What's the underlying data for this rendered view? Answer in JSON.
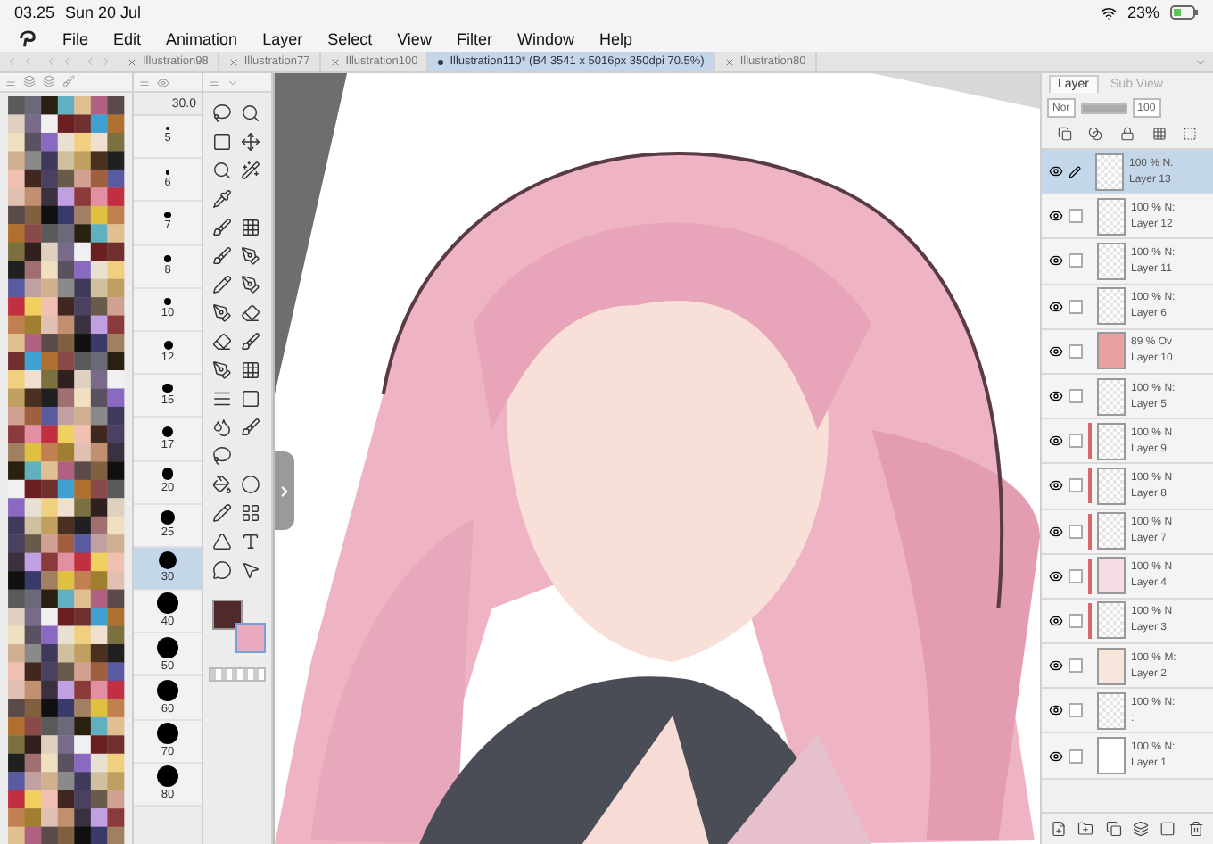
{
  "status_bar": {
    "time": "03.25",
    "date": "Sun 20 Jul",
    "battery": "23%"
  },
  "menu": [
    "File",
    "Edit",
    "Animation",
    "Layer",
    "Select",
    "View",
    "Filter",
    "Window",
    "Help"
  ],
  "document_tabs": [
    {
      "label": "Illustration98",
      "selected": false
    },
    {
      "label": "Illustration77",
      "selected": false
    },
    {
      "label": "Illustration100",
      "selected": false
    },
    {
      "label": "Illustration110* (B4 3541 x 5016px 350dpi 70.5%)",
      "selected": true
    },
    {
      "label": "Illustration80",
      "selected": false
    }
  ],
  "brush_size": {
    "value": "30.0",
    "sizes": [
      {
        "label": "5",
        "selected": false
      },
      {
        "label": "6",
        "selected": false
      },
      {
        "label": "7",
        "selected": false
      },
      {
        "label": "8",
        "selected": false
      },
      {
        "label": "10",
        "selected": false
      },
      {
        "label": "12",
        "selected": false
      },
      {
        "label": "15",
        "selected": false
      },
      {
        "label": "17",
        "selected": false
      },
      {
        "label": "20",
        "selected": false
      },
      {
        "label": "25",
        "selected": false
      },
      {
        "label": "30",
        "selected": true
      },
      {
        "label": "40",
        "selected": false
      },
      {
        "label": "50",
        "selected": false
      },
      {
        "label": "60",
        "selected": false
      },
      {
        "label": "70",
        "selected": false
      },
      {
        "label": "80",
        "selected": false
      }
    ]
  },
  "colors": {
    "main": {
      "color": "#4e2a2c"
    },
    "sub": {
      "color": "#e8aabc"
    }
  },
  "layer_panel": {
    "tabs": [
      {
        "label": "Layer",
        "selected": true
      },
      {
        "label": "Sub View",
        "selected": false
      }
    ],
    "blend": "Nor",
    "opacity": "100",
    "opacity_slider": {
      "level": 1
    },
    "layers": [
      {
        "name": "Layer 13",
        "opacity": "100 %",
        "blend": "N:",
        "selected": true,
        "clipped": false,
        "kind": "empty"
      },
      {
        "name": "Layer 12",
        "opacity": "100 %",
        "blend": "N:",
        "selected": false,
        "clipped": false,
        "kind": "sketch"
      },
      {
        "name": "Layer 11",
        "opacity": "100 %",
        "blend": "N:",
        "selected": false,
        "clipped": false,
        "kind": "empty"
      },
      {
        "name": "Layer 6",
        "opacity": "100 %",
        "blend": "N:",
        "selected": false,
        "clipped": false,
        "kind": "empty"
      },
      {
        "name": "Layer 10",
        "opacity": "89 %",
        "blend": "Ov",
        "selected": false,
        "clipped": false,
        "kind": "red"
      },
      {
        "name": "Layer 5",
        "opacity": "100 %",
        "blend": "N:",
        "selected": false,
        "clipped": false,
        "kind": "empty"
      },
      {
        "name": "Layer 9",
        "opacity": "100 %",
        "blend": "N",
        "selected": false,
        "clipped": true,
        "kind": "empty"
      },
      {
        "name": "Layer 8",
        "opacity": "100 %",
        "blend": "N",
        "selected": false,
        "clipped": true,
        "kind": "sketch"
      },
      {
        "name": "Layer 7",
        "opacity": "100 %",
        "blend": "N",
        "selected": false,
        "clipped": true,
        "kind": "sketch"
      },
      {
        "name": "Layer 4",
        "opacity": "100 %",
        "blend": "N",
        "selected": false,
        "clipped": true,
        "kind": "pink"
      },
      {
        "name": "Layer 3",
        "opacity": "100 %",
        "blend": "N",
        "selected": false,
        "clipped": true,
        "kind": "empty"
      },
      {
        "name": "Layer 2",
        "opacity": "100 %",
        "blend": "M:",
        "selected": false,
        "clipped": false,
        "kind": "skin"
      },
      {
        "name": ":",
        "opacity": "100 %",
        "blend": "N:",
        "selected": false,
        "clipped": false,
        "kind": "lineart"
      },
      {
        "name": "Layer 1",
        "opacity": "100 %",
        "blend": "N:",
        "selected": false,
        "clipped": false,
        "kind": "white"
      }
    ]
  }
}
